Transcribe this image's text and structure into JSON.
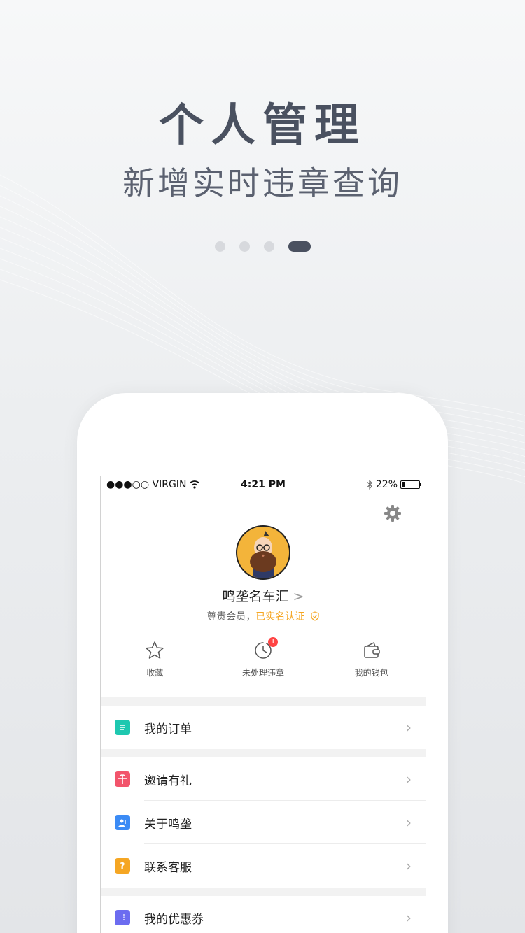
{
  "hero": {
    "title": "个人管理",
    "subtitle": "新增实时违章查询",
    "page_dots": 4,
    "active_dot": 4
  },
  "status_bar": {
    "carrier": "●●●○○ VIRGIN",
    "time": "4:21 PM",
    "battery": "22%",
    "battery_level": 0.22
  },
  "profile": {
    "name": "鸣垄名车汇",
    "name_chevron": ">",
    "member_label": "尊贵会员，",
    "verified_label": "已实名认证"
  },
  "quick_actions": [
    {
      "label": "收藏",
      "icon": "star-icon"
    },
    {
      "label": "未处理违章",
      "icon": "clock-icon",
      "badge": "1"
    },
    {
      "label": "我的钱包",
      "icon": "wallet-icon"
    }
  ],
  "menu": [
    {
      "label": "我的订单",
      "icon": "order-icon",
      "color": "#1ec8b0"
    },
    {
      "label": "邀请有礼",
      "icon": "gift-icon",
      "color": "#f2546b"
    },
    {
      "label": "关于鸣垄",
      "icon": "about-icon",
      "color": "#3b8bf5"
    },
    {
      "label": "联系客服",
      "icon": "service-icon",
      "color": "#f5a623"
    },
    {
      "label": "我的优惠券",
      "icon": "coupon-icon",
      "color": "#6c6cf0"
    }
  ],
  "colors": {
    "accent_dark": "#4a5160",
    "verified": "#f5a623",
    "badge": "#ff4444"
  }
}
